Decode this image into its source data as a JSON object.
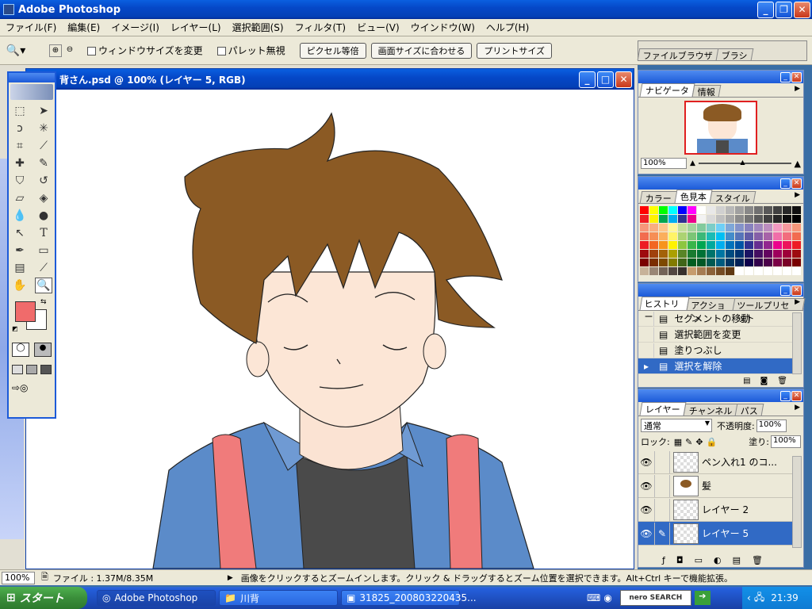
{
  "app": {
    "title": "Adobe Photoshop"
  },
  "menu": [
    "ファイル(F)",
    "編集(E)",
    "イメージ(I)",
    "レイヤー(L)",
    "選択範囲(S)",
    "フィルタ(T)",
    "ビュー(V)",
    "ウインドウ(W)",
    "ヘルプ(H)"
  ],
  "options": {
    "resize_window": "ウィンドウサイズを変更",
    "ignore_palette": "パレット無視",
    "actual_pixels": "ピクセル等倍",
    "fit_on_screen": "画面サイズに合わせる",
    "print_size": "プリントサイズ"
  },
  "palette_well": {
    "tabs": [
      "ファイルブラウザ",
      "ブラシ"
    ]
  },
  "document": {
    "title": "背さん.psd @ 100% (レイヤー 5, RGB)"
  },
  "navigator": {
    "tabs": [
      "ナビゲータ",
      "情報"
    ],
    "zoom": "100%"
  },
  "swatches": {
    "tabs": [
      "カラー",
      "色見本",
      "スタイル"
    ],
    "colors": [
      [
        "#ff0000",
        "#ffff00",
        "#00ff00",
        "#00ffff",
        "#0000ff",
        "#ff00ff",
        "#ffffff",
        "#e8e8e8",
        "#d0d0d0",
        "#b8b8b8",
        "#a0a0a0",
        "#888888",
        "#707070",
        "#585858",
        "#404040",
        "#282828",
        "#101010"
      ],
      [
        "#ee1d24",
        "#fff200",
        "#00a650",
        "#00aeef",
        "#2e3192",
        "#ec008c",
        "#f2f2f2",
        "#d9d9d9",
        "#bfbfbf",
        "#a6a6a6",
        "#8c8c8c",
        "#737373",
        "#595959",
        "#404040",
        "#262626",
        "#0d0d0d",
        "#000000"
      ],
      [
        "#f7977a",
        "#f9ad81",
        "#fdc68a",
        "#fff79a",
        "#c4df9b",
        "#a3d39c",
        "#82ca9d",
        "#7bcdc8",
        "#6ecff6",
        "#7ea7d8",
        "#8493ca",
        "#8882be",
        "#a187be",
        "#bc8dbf",
        "#f49ac2",
        "#f6989d",
        "#f7977a"
      ],
      [
        "#f26c4f",
        "#f68e55",
        "#fbaf5c",
        "#fff467",
        "#acd372",
        "#7cc576",
        "#3bb878",
        "#1abbb4",
        "#00bff3",
        "#438cca",
        "#5574b9",
        "#605ca8",
        "#855fa8",
        "#a763a8",
        "#f06ea9",
        "#f26d7d",
        "#f26c4f"
      ],
      [
        "#ed1c24",
        "#f26522",
        "#f7941d",
        "#fff200",
        "#8dc63f",
        "#39b54a",
        "#00a651",
        "#00a99d",
        "#00aeef",
        "#0072bc",
        "#0054a6",
        "#2e3192",
        "#662d91",
        "#92278f",
        "#ec008c",
        "#ed145b",
        "#ed1c24"
      ],
      [
        "#9e0b0f",
        "#a0410d",
        "#a36209",
        "#aba000",
        "#598527",
        "#1a7b30",
        "#007236",
        "#00746b",
        "#0076a3",
        "#004b80",
        "#003471",
        "#1b1464",
        "#440e62",
        "#630460",
        "#9e005d",
        "#9e0039",
        "#9e0b0f"
      ],
      [
        "#790000",
        "#7b2e00",
        "#7d4900",
        "#827b00",
        "#406618",
        "#005e20",
        "#005826",
        "#005952",
        "#005b7f",
        "#003663",
        "#002157",
        "#0d004c",
        "#32004b",
        "#4b0049",
        "#7b0046",
        "#7a0026",
        "#790000"
      ],
      [
        "#c7b299",
        "#998675",
        "#736357",
        "#534741",
        "#37302d",
        "#c69c6d",
        "#a67c52",
        "#8c6239",
        "#754c24",
        "#603913",
        "#ffffff",
        "#ffffff",
        "#ffffff",
        "#ffffff",
        "#ffffff",
        "#ffffff",
        "#ffffff"
      ]
    ]
  },
  "history": {
    "tabs": [
      "ヒストリー",
      "アクション",
      "ツールプリセット"
    ],
    "items": [
      "セグメントの移動",
      "選択範囲を変更",
      "塗りつぶし",
      "選択を解除"
    ]
  },
  "layers": {
    "tabs": [
      "レイヤー",
      "チャンネル",
      "パス"
    ],
    "blend_mode": "通常",
    "opacity_label": "不透明度:",
    "opacity": "100%",
    "lock_label": "ロック:",
    "fill_label": "塗り:",
    "fill": "100%",
    "items": [
      "ペン入れ1 のコ...",
      "髪",
      "レイヤー 2",
      "レイヤー 5"
    ]
  },
  "status": {
    "zoom": "100%",
    "file_info": "ファイル : 1.37M/8.35M",
    "hint": "画像をクリックするとズームインします。クリック & ドラッグするとズーム位置を選択できます。Alt+Ctrl キーで機能拡張。"
  },
  "taskbar": {
    "start": "スタート",
    "tasks": [
      "Adobe Photoshop",
      "川背",
      "31825_200803220435..."
    ],
    "clock": "21:39",
    "search_logo": "nero SEARCH"
  },
  "colors": {
    "foreground": "#f06b6b",
    "background": "#ffffff"
  }
}
